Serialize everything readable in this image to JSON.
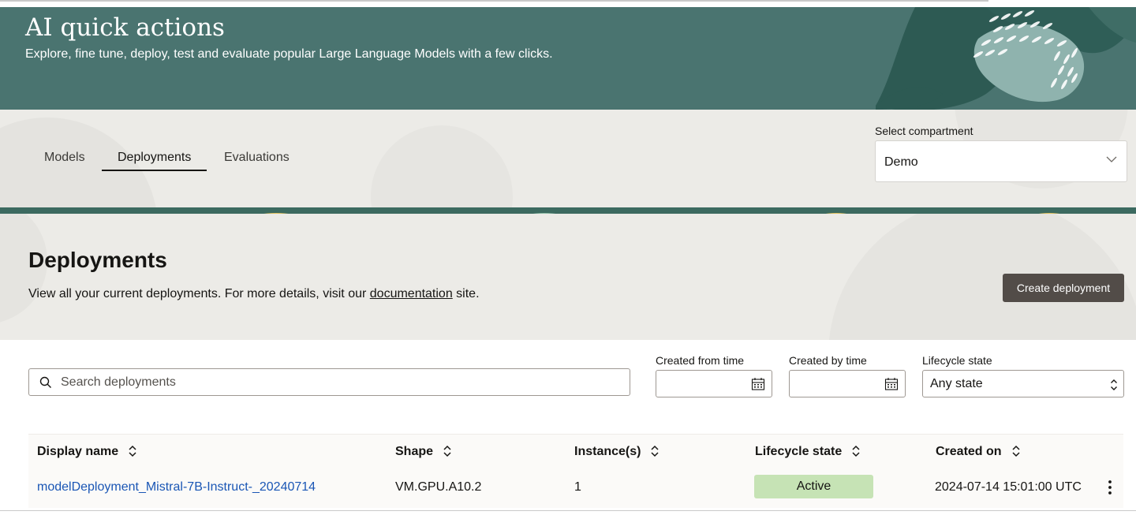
{
  "hero": {
    "title": "AI quick actions",
    "subtitle": "Explore, fine tune, deploy, test and evaluate popular Large Language Models with a few clicks."
  },
  "tabs": [
    {
      "label": "Models",
      "active": false
    },
    {
      "label": "Deployments",
      "active": true
    },
    {
      "label": "Evaluations",
      "active": false
    }
  ],
  "compartment": {
    "label": "Select compartment",
    "value": "Demo"
  },
  "section": {
    "title": "Deployments",
    "desc_before": "View all your current deployments. For more details, visit our ",
    "desc_link": "documentation",
    "desc_after": " site.",
    "create_button": "Create deployment"
  },
  "filters": {
    "search_placeholder": "Search deployments",
    "created_from_label": "Created from time",
    "created_by_label": "Created by time",
    "lifecycle_label": "Lifecycle state",
    "lifecycle_value": "Any state"
  },
  "table": {
    "columns": [
      "Display name",
      "Shape",
      "Instance(s)",
      "Lifecycle state",
      "Created on"
    ],
    "rows": [
      {
        "display_name": "modelDeployment_Mistral-7B-Instruct-_20240714",
        "shape": "VM.GPU.A10.2",
        "instances": "1",
        "lifecycle_state": "Active",
        "created_on": "2024-07-14 15:01:00 UTC"
      }
    ]
  },
  "colors": {
    "hero_bg": "#4a7470",
    "band_bg": "#ecebe7",
    "primary_button": "#524c48",
    "link": "#1a56b5",
    "active_badge": "#c6e3b5"
  }
}
